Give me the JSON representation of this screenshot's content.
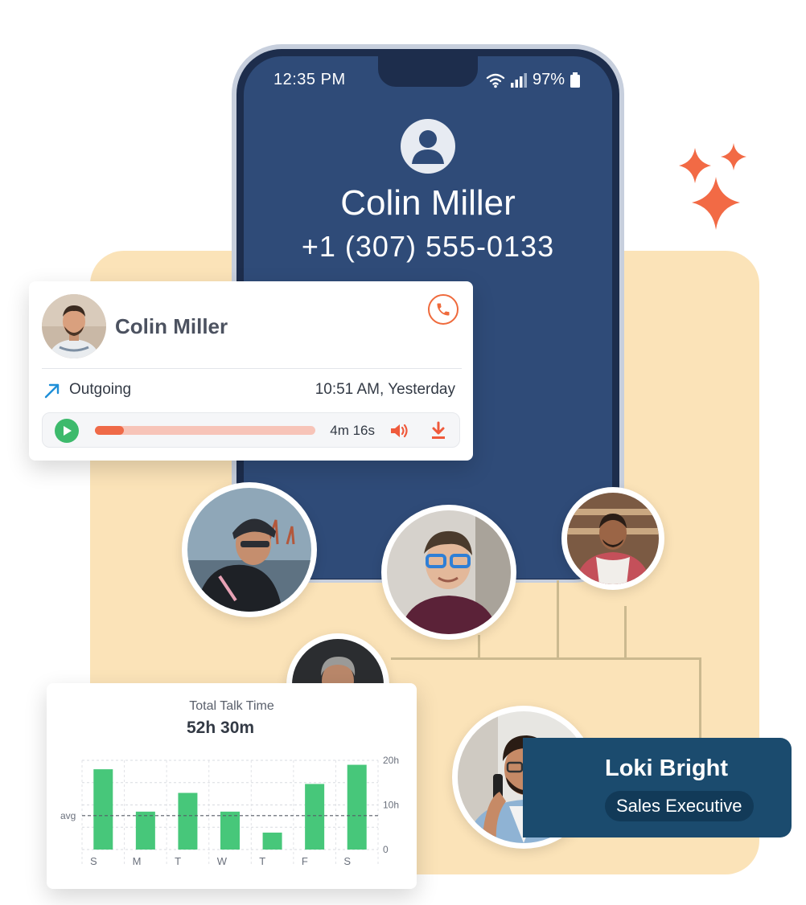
{
  "phone": {
    "status_time": "12:35 PM",
    "battery": "97%",
    "caller_name": "Colin Miller",
    "caller_number": "+1 (307) 555-0133"
  },
  "call_card": {
    "contact_name": "Colin Miller",
    "direction": "Outgoing",
    "time": "10:51 AM, Yesterday",
    "duration": "4m 16s",
    "progress": 0.13
  },
  "profile": {
    "name": "Loki Bright",
    "role": "Sales Executive"
  },
  "talk_time": {
    "title": "Total Talk Time",
    "value": "52h 30m"
  },
  "chart_data": {
    "type": "bar",
    "title": "Total Talk Time",
    "categories": [
      "S",
      "M",
      "T",
      "W",
      "T",
      "F",
      "S"
    ],
    "values": [
      18,
      8.5,
      12.7,
      8.5,
      3.8,
      14.7,
      19
    ],
    "ylim": [
      0,
      20
    ],
    "yticks": [
      "0",
      "10h",
      "20h"
    ],
    "avg_label": "avg",
    "avg_value": 7.6,
    "bar_color": "#47c77a",
    "grid": true
  },
  "colors": {
    "accent": "#ef6a3c",
    "phone_screen": "#2f4b78",
    "panel": "#fbe3b8",
    "profile_card": "#1b4b6e"
  }
}
